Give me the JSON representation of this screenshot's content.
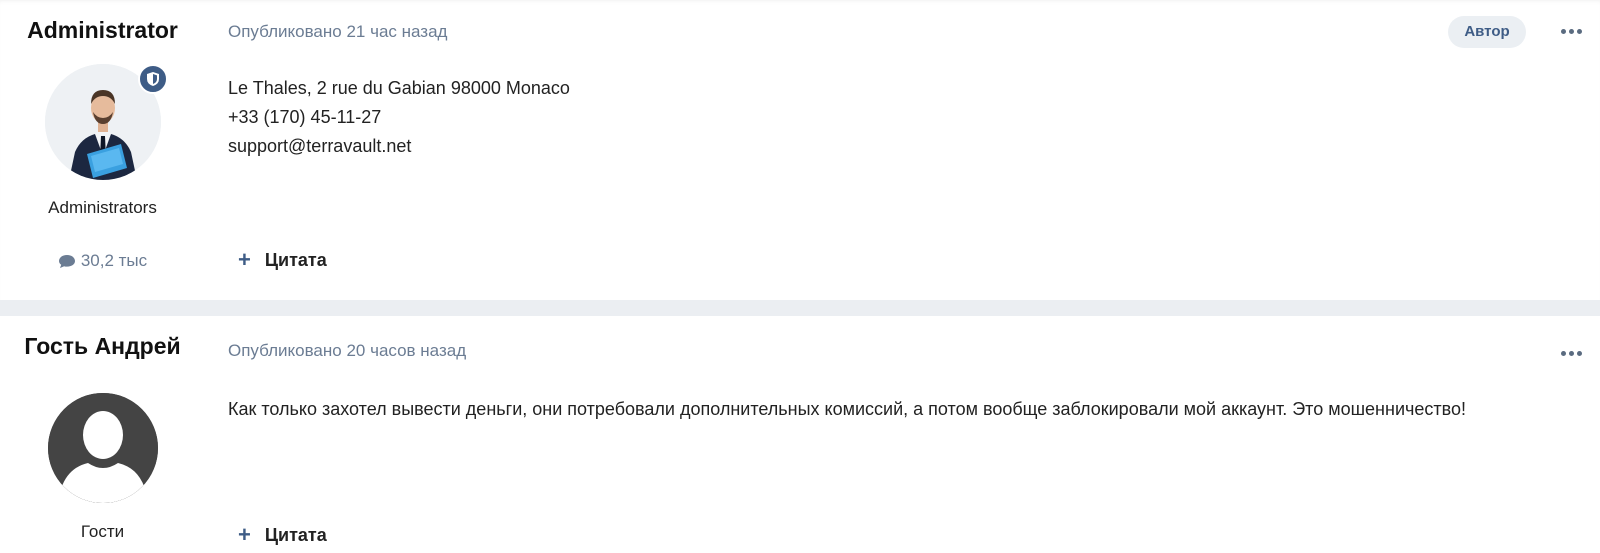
{
  "posts": [
    {
      "author": "Administrator",
      "group": "Administrators",
      "post_count": "30,2 тыс",
      "meta": "Опубликовано 21 час назад",
      "author_badge": "Автор",
      "content_lines": [
        "Le Thales, 2 rue du Gabian 98000 Monaco",
        "+33 (170) 45-11-27",
        "support@terravault.net"
      ],
      "quote_label": "Цитата"
    },
    {
      "author": "Гость Андрей",
      "group": "Гости",
      "meta": "Опубликовано 20 часов назад",
      "content_lines": [
        "Как только захотел вывести деньги, они потребовали дополнительных комиссий, а потом вообще заблокировали мой аккаунт. Это мошенничество!"
      ],
      "quote_label": "Цитата"
    }
  ],
  "icons": {
    "shield": "shield-icon",
    "comment": "comment-icon",
    "more": "ellipsis-icon",
    "plus": "plus-icon"
  },
  "colors": {
    "accent": "#3e5c86",
    "meta_text": "#6b7c93",
    "separator": "#ebeef2"
  }
}
